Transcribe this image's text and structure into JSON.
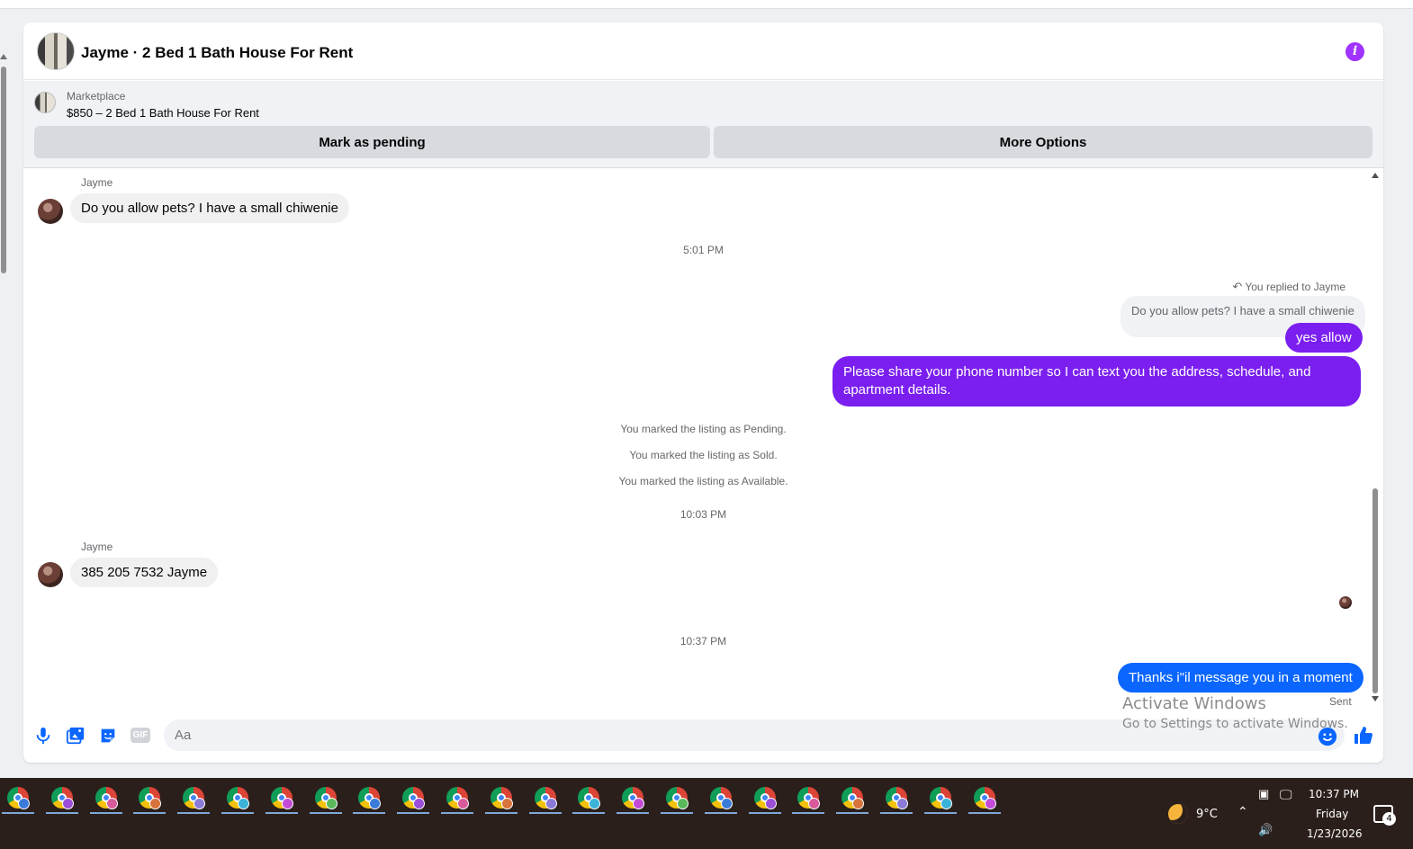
{
  "chat": {
    "title": "Jayme · 2 Bed 1 Bath House For Rent",
    "info_icon": "info-icon",
    "accent_color": "#7a1fef"
  },
  "marketplace": {
    "label": "Marketplace",
    "item": "$850 – 2 Bed 1 Bath House For Rent",
    "mark_pending_label": "Mark as pending",
    "more_options_label": "More Options"
  },
  "thread": {
    "msg1_sender": "Jayme",
    "msg1_text": "Do you allow pets? I have a small chiwenie",
    "time1": "5:01 PM",
    "reply_note": "You replied to Jayme",
    "reply_quote": "Do you allow pets? I have a small chiwenie",
    "out1_text": "yes allow",
    "out2_text": "Please share your phone number so I can text you the address, schedule, and apartment details.",
    "sys1": "You marked the listing as Pending.",
    "sys2": "You marked the listing as Sold.",
    "sys3": "You marked the listing as Available.",
    "time2": "10:03 PM",
    "msg2_sender": "Jayme",
    "msg2_text": "385 205 7532 Jayme",
    "time3": "10:37 PM",
    "out3_text": "Thanks i\"il message you in a moment",
    "sent_label": "Sent"
  },
  "composer": {
    "placeholder": "Aa",
    "icons": [
      "microphone-icon",
      "photo-icon",
      "sticker-icon",
      "gif-icon",
      "emoji-icon",
      "thumbs-up-icon"
    ],
    "gif_label": "GIF"
  },
  "watermark": {
    "line1": "Activate Windows",
    "line2": "Go to Settings to activate Windows."
  },
  "taskbar": {
    "app_count": 23,
    "temperature": "9°C",
    "time": "10:37 PM",
    "day": "Friday",
    "date": "1/23/2026",
    "notification_count": "4"
  }
}
